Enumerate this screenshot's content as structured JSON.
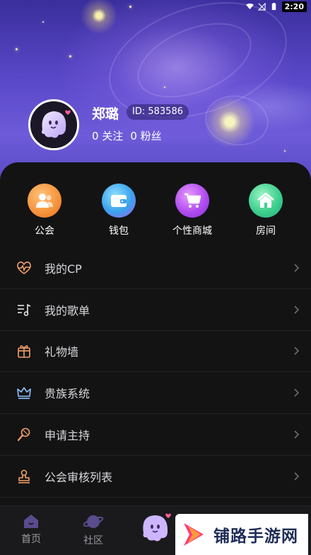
{
  "status_bar": {
    "time": "2:20"
  },
  "profile": {
    "name": "郑璐",
    "id_text": "ID: 583586",
    "following_text": "0 关注",
    "fans_text": "0 粉丝"
  },
  "quick_actions": [
    {
      "label": "公会",
      "icon": "guild-icon",
      "color": "#f5923a"
    },
    {
      "label": "钱包",
      "icon": "wallet-icon",
      "color": "#3aa2ee"
    },
    {
      "label": "个性商城",
      "icon": "shopping-cart-icon",
      "color": "#b14df0"
    },
    {
      "label": "房间",
      "icon": "home-icon",
      "color": "#3ecf8e"
    }
  ],
  "menu_items": [
    {
      "label": "我的CP",
      "icon": "heartbeat-icon"
    },
    {
      "label": "我的歌单",
      "icon": "playlist-icon"
    },
    {
      "label": "礼物墙",
      "icon": "gift-box-icon"
    },
    {
      "label": "贵族系统",
      "icon": "crown-icon"
    },
    {
      "label": "申请主持",
      "icon": "microphone-icon"
    },
    {
      "label": "公会审核列表",
      "icon": "stamp-icon"
    }
  ],
  "tab_bar": [
    {
      "label": "首页",
      "icon": "home-tab-icon"
    },
    {
      "label": "社区",
      "icon": "planet-icon"
    },
    {
      "label": "",
      "icon": "ghost-mascot-icon"
    }
  ],
  "watermark": {
    "text": "铺路手游网"
  }
}
